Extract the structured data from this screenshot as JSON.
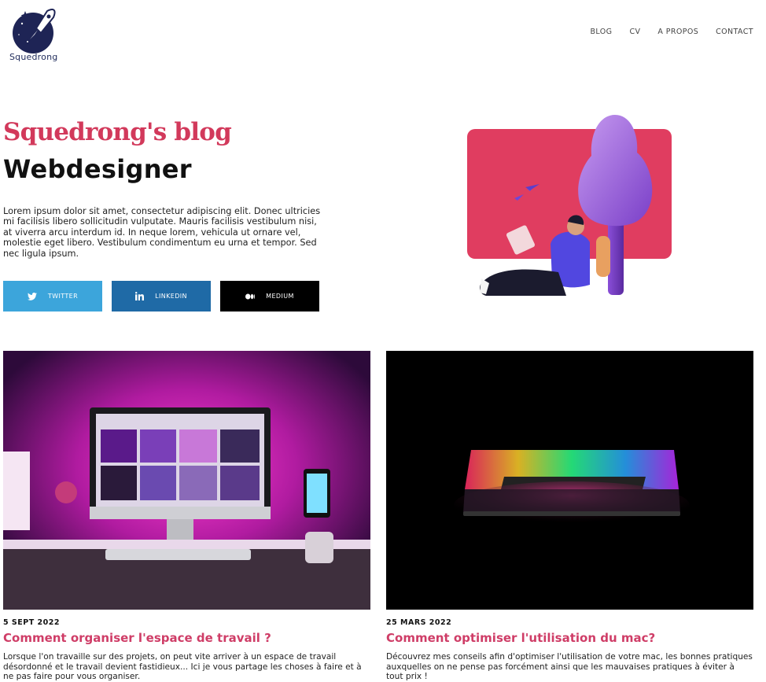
{
  "brand": {
    "name": "Squedrong"
  },
  "nav": {
    "items": [
      {
        "label": "BLOG"
      },
      {
        "label": "CV"
      },
      {
        "label": "A PROPOS"
      },
      {
        "label": "CONTACT"
      }
    ]
  },
  "hero": {
    "title": "Squedrong's blog",
    "subtitle": "Webdesigner",
    "description": "Lorem ipsum dolor sit amet, consectetur adipiscing elit. Donec ultricies mi facilisis libero sollicitudin vulputate. Mauris facilisis vestibulum nisi, at viverra arcu interdum id. In neque lorem, vehicula ut ornare vel, molestie eget libero. Vestibulum condimentum eu urna et tempor. Sed nec ligula ipsum."
  },
  "social": [
    {
      "label": "TWITTER",
      "icon": "twitter-icon",
      "color": "#3ca5db"
    },
    {
      "label": "LINKEDIN",
      "icon": "linkedin-icon",
      "color": "#1f6aa6"
    },
    {
      "label": "MEDIUM",
      "icon": "medium-icon",
      "color": "#000000"
    }
  ],
  "colors": {
    "accent": "#d2395b",
    "illustration_bg": "#e03d60"
  },
  "posts": [
    {
      "date": "5 SEPT 2022",
      "title": "Comment organiser l'espace de travail ?",
      "excerpt": "Lorsque l'on travaille sur des projets, on peut vite arriver à un espace de travail désordonné et le travail devient fastidieux... Ici je vous partage les choses à faire et à ne pas faire pour vous organiser."
    },
    {
      "date": "25 MARS 2022",
      "title": "Comment optimiser l'utilisation du mac?",
      "excerpt": "Découvrez mes conseils afin d'optimiser l'utilisation de votre mac, les bonnes pratiques auxquelles on ne pense pas forcément ainsi que les mauvaises pratiques à éviter à tout prix !"
    }
  ]
}
